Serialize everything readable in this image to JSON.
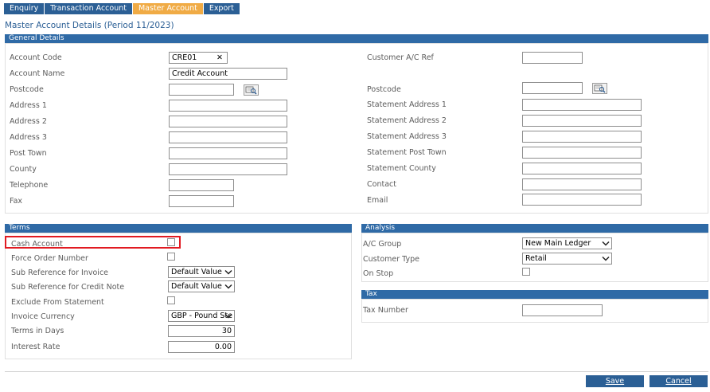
{
  "tabs": [
    {
      "label": "Enquiry",
      "active": false
    },
    {
      "label": "Transaction Account",
      "active": false
    },
    {
      "label": "Master Account",
      "active": true
    },
    {
      "label": "Export",
      "active": false
    }
  ],
  "page_title": "Master Account Details (Period 11/2023)",
  "general": {
    "title": "General Details",
    "account_code_label": "Account Code",
    "account_code_value": "CRE01",
    "clear_glyph": "✕",
    "account_name_label": "Account Name",
    "account_name_value": "Credit Account",
    "postcode_label": "Postcode",
    "address1_label": "Address 1",
    "address2_label": "Address 2",
    "address3_label": "Address 3",
    "post_town_label": "Post Town",
    "county_label": "County",
    "telephone_label": "Telephone",
    "fax_label": "Fax",
    "customer_ref_label": "Customer A/C Ref",
    "stmt_postcode_label": "Postcode",
    "stmt_address1_label": "Statement Address 1",
    "stmt_address2_label": "Statement Address 2",
    "stmt_address3_label": "Statement Address 3",
    "stmt_post_town_label": "Statement Post Town",
    "stmt_county_label": "Statement County",
    "contact_label": "Contact",
    "email_label": "Email"
  },
  "terms": {
    "title": "Terms",
    "cash_account_label": "Cash Account",
    "force_order_label": "Force Order Number",
    "sub_ref_invoice_label": "Sub Reference for Invoice",
    "sub_ref_invoice_value": "Default Value",
    "sub_ref_credit_label": "Sub Reference for Credit Note",
    "sub_ref_credit_value": "Default Value",
    "exclude_label": "Exclude From Statement",
    "currency_label": "Invoice Currency",
    "currency_value": "GBP - Pound Ste",
    "terms_days_label": "Terms in Days",
    "terms_days_value": "30",
    "interest_label": "Interest Rate",
    "interest_value": "0.00"
  },
  "analysis": {
    "title": "Analysis",
    "ac_group_label": "A/C Group",
    "ac_group_value": "New Main Ledger",
    "customer_type_label": "Customer Type",
    "customer_type_value": "Retail",
    "on_stop_label": "On Stop"
  },
  "tax": {
    "title": "Tax",
    "tax_number_label": "Tax Number"
  },
  "footer": {
    "save_label": "Save",
    "cancel_label": "Cancel"
  },
  "colors": {
    "tab_blue": "#2b5f95",
    "tab_active": "#f0ab45",
    "section_bar": "#2f6aa6",
    "highlight": "#e11b22"
  }
}
